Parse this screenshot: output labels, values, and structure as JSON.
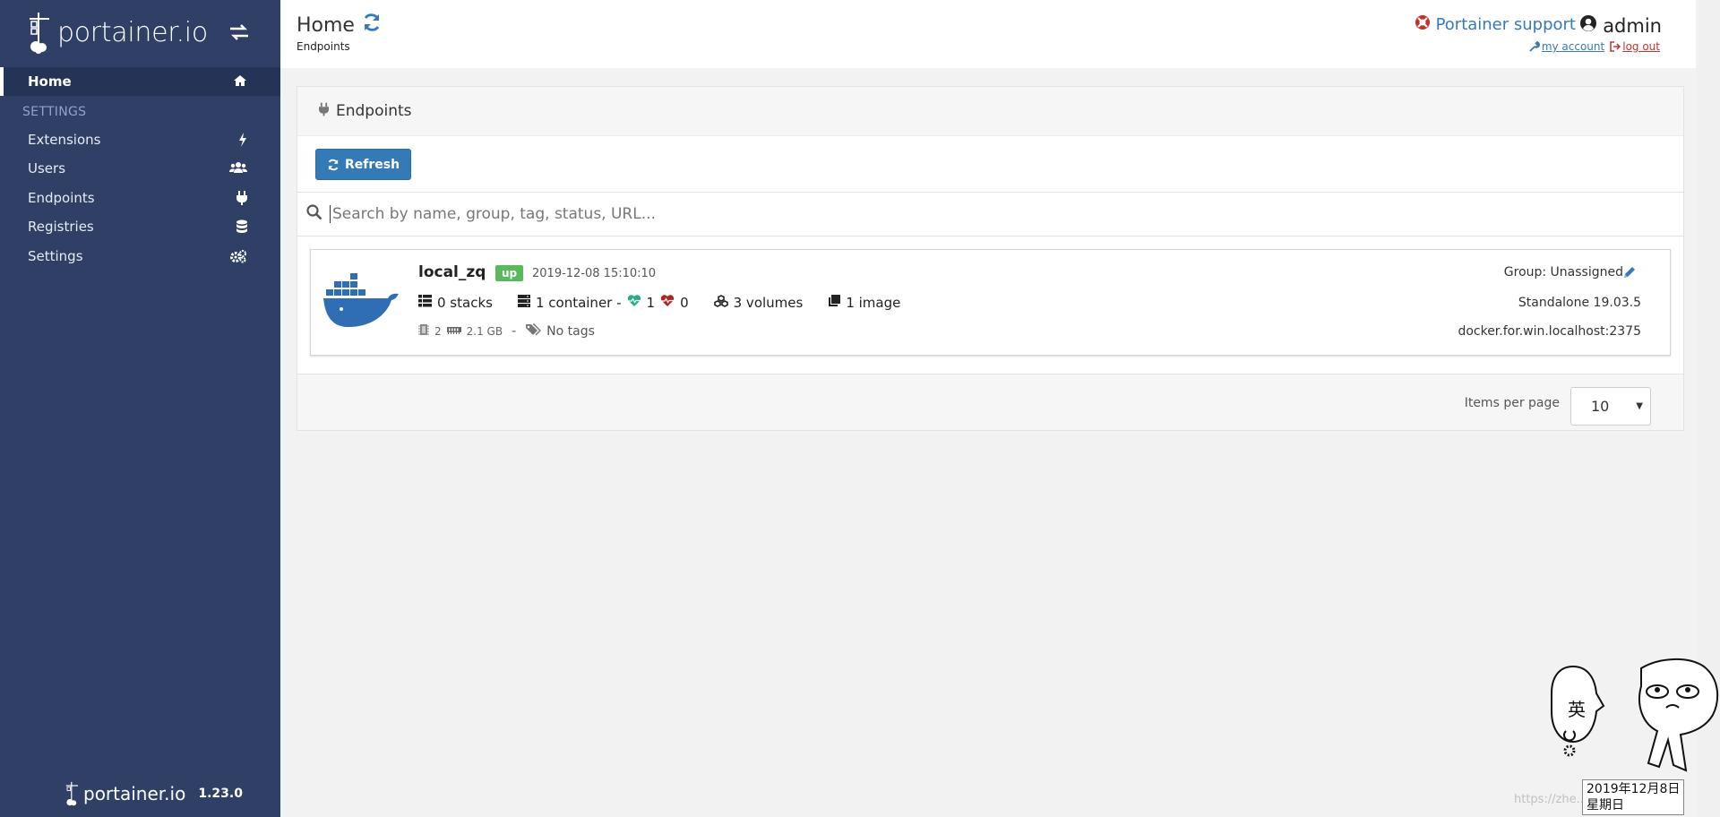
{
  "app": {
    "logo_text": "portainer.io",
    "version": "1.23.0"
  },
  "sidebar": {
    "items": [
      {
        "label": "Home",
        "icon": "home-icon",
        "active": true
      },
      {
        "label": "Extensions",
        "icon": "bolt-icon"
      },
      {
        "label": "Users",
        "icon": "users-icon"
      },
      {
        "label": "Endpoints",
        "icon": "plug-icon"
      },
      {
        "label": "Registries",
        "icon": "database-icon"
      },
      {
        "label": "Settings",
        "icon": "cogs-icon"
      }
    ],
    "section_label": "SETTINGS"
  },
  "header": {
    "title": "Home",
    "breadcrumb": "Endpoints",
    "support_label": "Portainer support",
    "username": "admin",
    "my_account": "my account",
    "log_out": "log out"
  },
  "panel": {
    "title": "Endpoints",
    "refresh_label": "Refresh",
    "search_placeholder": "Search by name, group, tag, status, URL...",
    "items_per_page_label": "Items per page",
    "items_per_page_value": "10"
  },
  "endpoint": {
    "name": "local_zq",
    "status": "up",
    "date": "2019-12-08 15:10:10",
    "stacks": "0 stacks",
    "containers": "1 container -",
    "healthy": "1",
    "unhealthy": "0",
    "volumes": "3 volumes",
    "images": "1 image",
    "cpu": "2",
    "memory": "2.1 GB",
    "dash": "-",
    "tags": "No tags",
    "group": "Group: Unassigned",
    "engine": "Standalone 19.03.5",
    "url": "docker.for.win.localhost:2375"
  },
  "overlay": {
    "date_line1": "2019年12月8日",
    "date_line2": "星期日",
    "ime_char": "英",
    "watermark": "https://zhe...blog.csdn.net"
  },
  "colors": {
    "sidebar_bg": "#2f3f66",
    "primary": "#337ab7",
    "success": "#5cb85c",
    "danger": "#c9302c"
  }
}
